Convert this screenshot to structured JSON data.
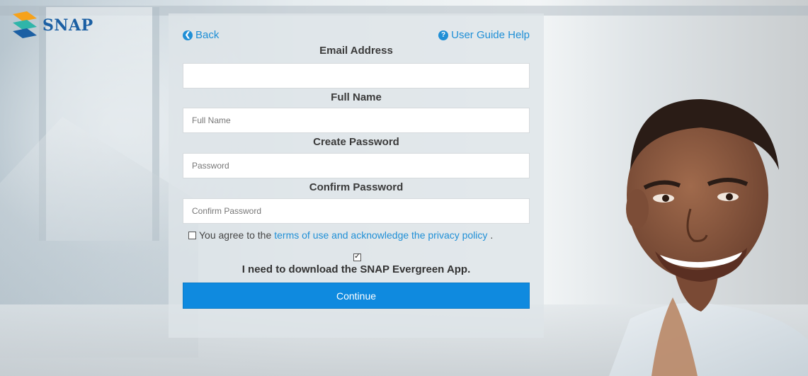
{
  "brand": {
    "name": "SNAP"
  },
  "nav": {
    "back_label": "Back",
    "help_label": "User Guide Help"
  },
  "form": {
    "email": {
      "label": "Email Address",
      "value": "",
      "placeholder": ""
    },
    "full_name": {
      "label": "Full Name",
      "value": "",
      "placeholder": "Full Name"
    },
    "password": {
      "label": "Create Password",
      "value": "",
      "placeholder": "Password"
    },
    "confirm_password": {
      "label": "Confirm Password",
      "value": "",
      "placeholder": "Confirm Password"
    },
    "agree": {
      "checked": false,
      "prefix": "You agree to the ",
      "link_text": "terms of use and acknowledge the privacy policy",
      "suffix": "."
    },
    "download_app": {
      "checked": true,
      "label": "I need to download the SNAP Evergreen App."
    },
    "continue_label": "Continue"
  },
  "colors": {
    "accent": "#1f8fd6",
    "button": "#0f8adf",
    "brand": "#1b5fa3"
  },
  "icons": {
    "back": "circle-arrow-left-icon",
    "help": "question-circle-icon",
    "logo": "snap-logo-icon"
  }
}
